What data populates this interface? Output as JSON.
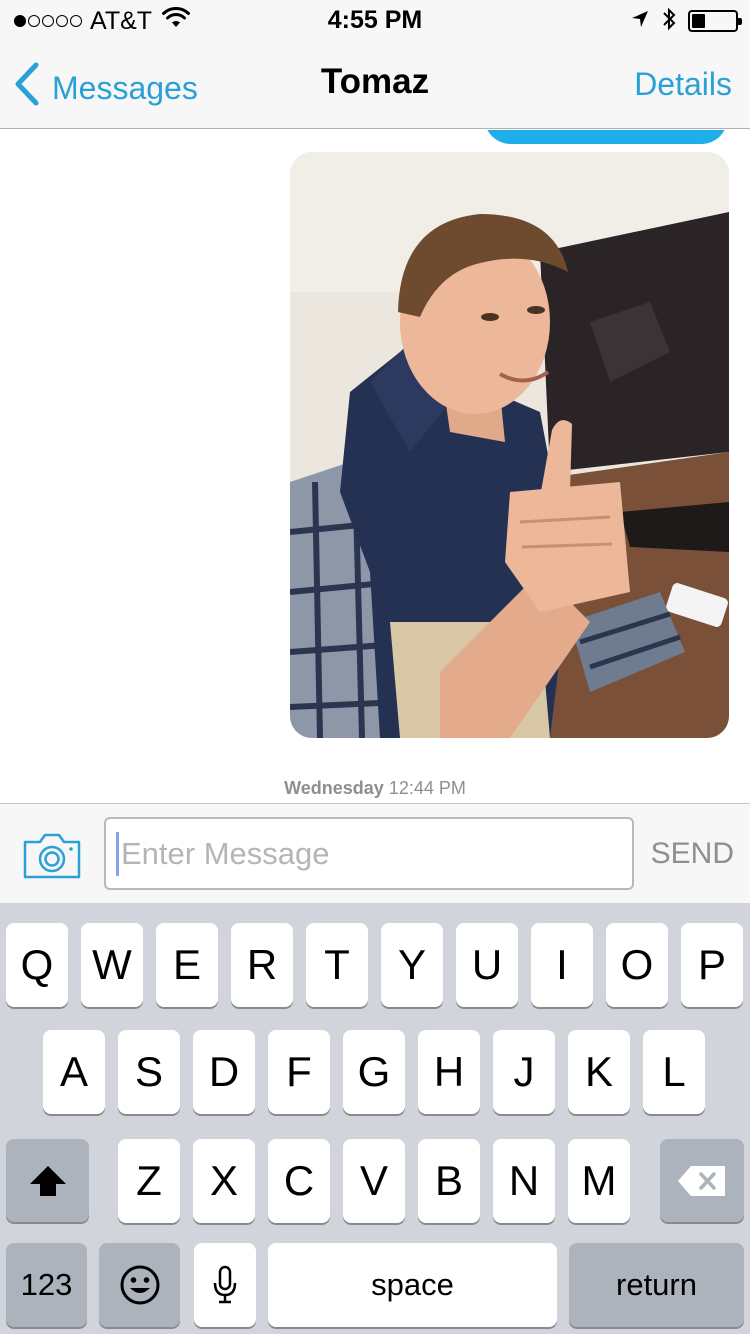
{
  "status_bar": {
    "carrier": "AT&T",
    "signal_bars": 1,
    "signal_total": 5,
    "time": "4:55 PM",
    "battery_level": 0.3
  },
  "nav": {
    "back_label": "Messages",
    "title": "Tomaz",
    "details_label": "Details"
  },
  "conversation": {
    "timestamp_day": "Wednesday",
    "timestamp_time": "12:44 PM"
  },
  "input": {
    "placeholder": "Enter Message",
    "send_label": "SEND"
  },
  "keyboard": {
    "row1": [
      "Q",
      "W",
      "E",
      "R",
      "T",
      "Y",
      "U",
      "I",
      "O",
      "P"
    ],
    "row2": [
      "A",
      "S",
      "D",
      "F",
      "G",
      "H",
      "J",
      "K",
      "L"
    ],
    "row3": [
      "Z",
      "X",
      "C",
      "V",
      "B",
      "N",
      "M"
    ],
    "numbers_label": "123",
    "space_label": "space",
    "return_label": "return"
  },
  "colors": {
    "accent": "#2aa1d6",
    "outgoing_bubble": "#1eaee9",
    "keyboard_bg": "#d1d5db"
  },
  "icons": [
    "back-chevron-icon",
    "location-arrow-icon",
    "bluetooth-icon",
    "battery-icon",
    "wifi-icon",
    "camera-icon",
    "shift-icon",
    "backspace-icon",
    "emoji-icon",
    "microphone-icon"
  ]
}
